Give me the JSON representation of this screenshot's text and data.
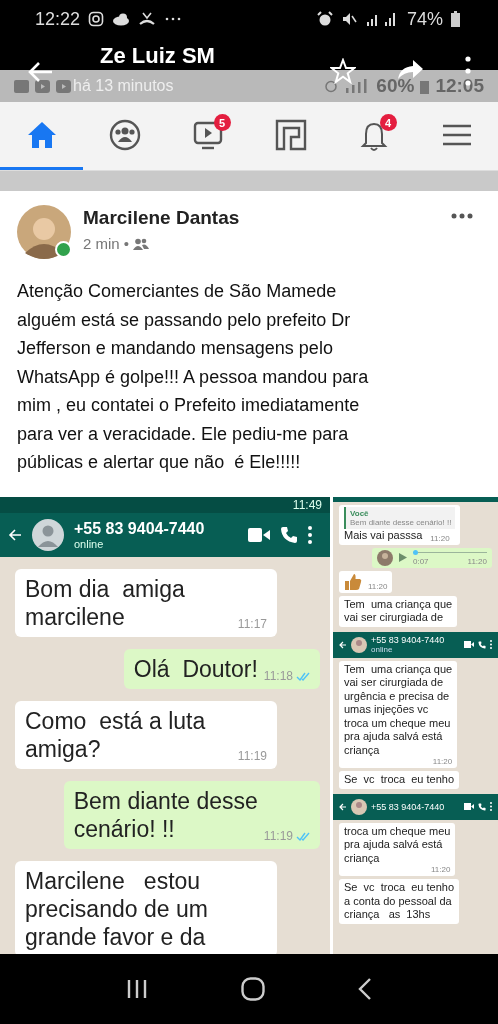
{
  "status_bar": {
    "time": "12:22",
    "battery": "74%"
  },
  "app_bar": {
    "title": "Ze Luiz SM"
  },
  "overlay_status_bar": {
    "subtitle": "há 13 minutos",
    "battery": "60%",
    "time": "12:05"
  },
  "nav_tabs": [
    {
      "kind": "home",
      "selected": true
    },
    {
      "kind": "groups",
      "selected": false
    },
    {
      "kind": "watch",
      "selected": false,
      "badge": "5"
    },
    {
      "kind": "marketplace",
      "selected": false
    },
    {
      "kind": "notifications",
      "selected": false,
      "badge": "4"
    },
    {
      "kind": "menu",
      "selected": false
    }
  ],
  "post": {
    "author": "Marcilene Dantas",
    "online": true,
    "time": "2 min",
    "separator": "•",
    "text": "Atenção Comerciantes de São Mamede\nalguém está se passando pelo prefeito Dr\nJefferson e mandando mensagens pelo\nWhatsApp é golpe!!! A pessoa mandou para\nmim , eu contatei o Prefeito imediatamente\npara ver a veracidade. Ele pediu-me para\npúblicas e alertar que não  é Ele!!!!!"
  },
  "chat_screenshot": {
    "status_time": "11:49",
    "contact": "+55 83 9404-7440",
    "presence": "online",
    "messages": [
      {
        "kind": "incoming",
        "text": "Bom dia  amiga\nmarcilene",
        "time": "11:17"
      },
      {
        "kind": "outgoing",
        "text": "Olá  Doutor!",
        "time": "11:18",
        "read": true
      },
      {
        "kind": "incoming",
        "text": "Como  está a luta\namiga?",
        "time": "11:19"
      },
      {
        "kind": "outgoing",
        "text": "Bem diante desse\ncenário! !!",
        "time": "11:19",
        "read": true
      },
      {
        "kind": "incoming",
        "text": "Marcilene   estou\nprecisando de um\ngrande favor e da"
      }
    ]
  },
  "side_crops": [
    {
      "items": [
        {
          "kind": "quote",
          "quote_author": "Você",
          "quote_text": "Bem diante desse cenário! !!",
          "text": "Mais vai passsa",
          "time": "11:20"
        },
        {
          "kind": "voice",
          "duration": "0:07",
          "time": "11:20"
        },
        {
          "kind": "sticker",
          "time": "11:20"
        },
        {
          "kind": "bubble",
          "text": "Tem  uma criança que\nvai ser cirurgiada de"
        }
      ]
    },
    {
      "header": {
        "contact": "+55 83 9404-7440",
        "presence": "online"
      },
      "items": [
        {
          "kind": "bubble",
          "text": "Tem  uma criança que\nvai ser cirurgiada de\nurgência e precisa de\numas injeções vc\ntroca um cheque meu\npra ajuda salvá está\ncriança",
          "time": "11:20"
        },
        {
          "kind": "bubble",
          "text": "Se  vc  troca  eu tenho"
        }
      ]
    },
    {
      "header": {
        "contact": "+55 83 9404-7440"
      },
      "items": [
        {
          "kind": "bubble",
          "text": "troca um cheque meu\npra ajuda salvá está\ncriança",
          "time": "11:20"
        },
        {
          "kind": "bubble",
          "text": "Se  vc  troca  eu tenho\na conta do pessoal da\ncriança   as  13hs"
        }
      ]
    }
  ]
}
